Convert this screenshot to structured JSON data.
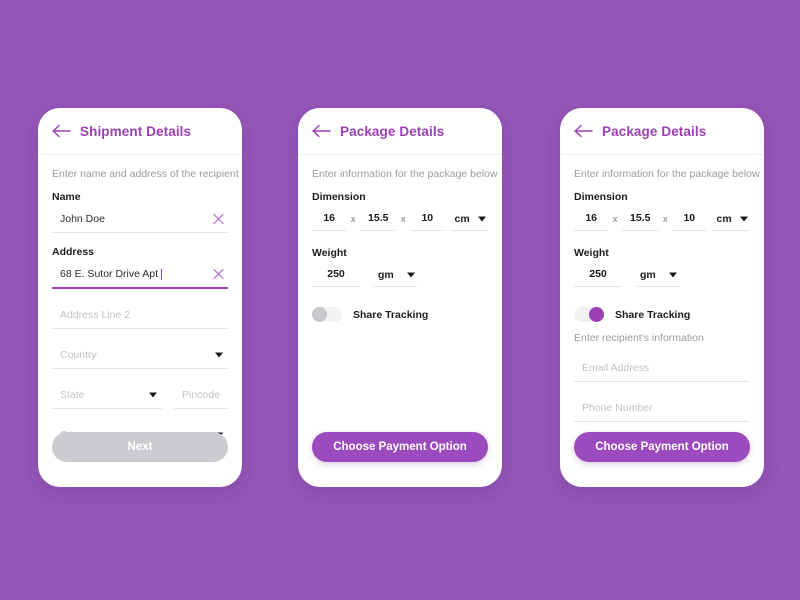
{
  "screen": {
    "background_color": "#9557b8",
    "accent_color": "#9c3fb4",
    "button_color": "#9c4bbe",
    "disabled_color": "#cdcbcf"
  },
  "cards": {
    "shipment": {
      "title": "Shipment Details",
      "back_icon": "arrow-left-icon",
      "subtitle": "Enter name and address of the recipient",
      "name_label": "Name",
      "name_value": "John Doe",
      "name_clear_icon": "close-icon",
      "address_label": "Address",
      "address_value": "68 E. Sutor Drive Apt",
      "address_clear_icon": "close-icon",
      "address2_placeholder": "Address Line 2",
      "country_placeholder": "Country",
      "state_placeholder": "State",
      "pincode_placeholder": "Pincode",
      "city_placeholder": "City",
      "next_label": "Next"
    },
    "package_collapsed": {
      "title": "Package Details",
      "back_icon": "arrow-left-icon",
      "subtitle": "Enter information for the package below",
      "dimension_label": "Dimension",
      "dim_length": "16",
      "dim_width": "15.5",
      "dim_height": "10",
      "dim_separator": "x",
      "dim_unit": "cm",
      "weight_label": "Weight",
      "weight_value": "250",
      "weight_unit": "gm",
      "share_tracking_label": "Share Tracking",
      "share_tracking_state": "off",
      "payment_label": "Choose Payment Option"
    },
    "package_expanded": {
      "title": "Package Details",
      "back_icon": "arrow-left-icon",
      "subtitle": "Enter information for the package below",
      "dimension_label": "Dimension",
      "dim_length": "16",
      "dim_width": "15.5",
      "dim_height": "10",
      "dim_separator": "x",
      "dim_unit": "cm",
      "weight_label": "Weight",
      "weight_value": "250",
      "weight_unit": "gm",
      "share_tracking_label": "Share Tracking",
      "share_tracking_state": "on",
      "recipient_subtitle": "Enter recipient's information",
      "email_placeholder": "Email Address",
      "phone_placeholder": "Phone Number",
      "payment_label": "Choose Payment Option"
    }
  }
}
